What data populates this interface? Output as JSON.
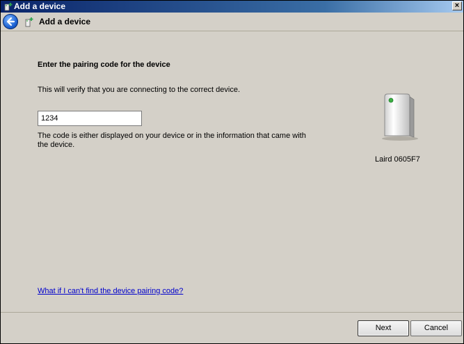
{
  "window": {
    "title": "Add a device",
    "close_glyph": "×"
  },
  "nav": {
    "title": "Add a device"
  },
  "main": {
    "heading": "Enter the pairing code for the device",
    "description": "This will verify that you are connecting to the correct device.",
    "code_value": "1234",
    "help_text": "The code is either displayed on your device or in the information that came with the device.",
    "help_link": "What if I can't find the device pairing code?"
  },
  "device": {
    "name": "Laird 0605F7",
    "icon": "bluetooth-device-icon"
  },
  "buttons": {
    "next_label": "Next",
    "cancel_label": "Cancel"
  },
  "colors": {
    "link": "#0000cc",
    "titlebar": "#0a246a",
    "status_led": "#3cb043"
  }
}
